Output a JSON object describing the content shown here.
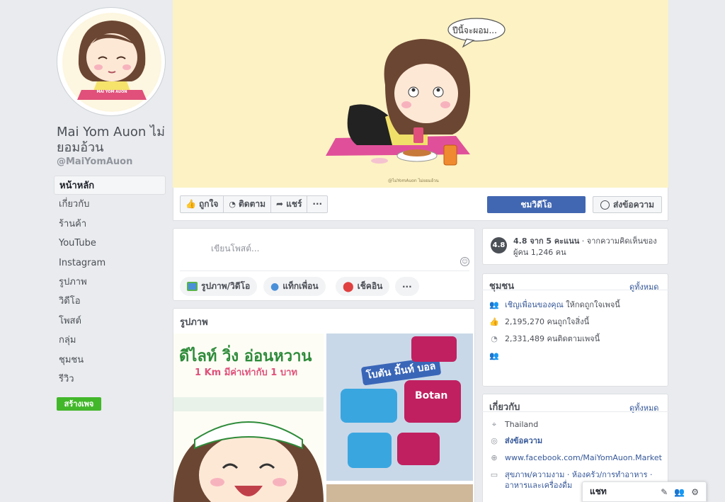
{
  "page": {
    "name": "Mai Yom Auon ไม่ยอมอ้วน",
    "handle": "@MaiYomAuon",
    "logo_text": "MAI YOM AUON"
  },
  "nav": {
    "items": [
      "หน้าหลัก",
      "เกี่ยวกับ",
      "ร้านค้า",
      "YouTube",
      "Instagram",
      "รูปภาพ",
      "วิดีโอ",
      "โพสต์",
      "กลุ่ม",
      "ชุมชน",
      "รีวิว"
    ],
    "create_page": "สร้างเพจ"
  },
  "cover": {
    "speech": "ปีนี้จะผอม...",
    "caption": "@ไม่YomAuon ไม่ยอมอ้วน"
  },
  "actions": {
    "like": "ถูกใจ",
    "follow": "ติดตาม",
    "share": "แชร์",
    "more": "···",
    "watch_video": "ชมวิดีโอ",
    "send_message": "ส่งข้อความ"
  },
  "composer": {
    "placeholder": "เขียนโพสต์...",
    "photo_video": "รูปภาพ/วิดีโอ",
    "tag_friends": "แท็กเพื่อน",
    "check_in": "เช็คอิน",
    "more": "···"
  },
  "photos": {
    "title": "รูปภาพ",
    "photo1_line1": "ดีไลท์ วิ่ง อ่อนหวาน",
    "photo1_line2": "1 Km มีค่าเท่ากับ 1 บาท",
    "photo2_label": "โบตัน มิ้นท์ บอล",
    "photo2_brand": "Botan"
  },
  "rating": {
    "score": "4.8",
    "summary": "4.8 จาก 5 คะแนน",
    "detail": " · จากความคิดเห็นของผู้คน 1,246 คน"
  },
  "community": {
    "title": "ชุมชน",
    "see_all": "ดูทั้งหมด",
    "invite_link": "เชิญเพื่อนของคุณ",
    "invite_rest": " ให้กดถูกใจเพจนี้",
    "likes": "2,195,270 คนถูกใจสิ่งนี้",
    "follows": "2,331,489 คนติดตามเพจนี้"
  },
  "about": {
    "title": "เกี่ยวกับ",
    "see_all": "ดูทั้งหมด",
    "location": "Thailand",
    "message": "ส่งข้อความ",
    "website": "www.facebook.com/MaiYomAuon.Market",
    "categories": "สุขภาพ/ความงาม · ห้องครัว/การทำอาหาร · อาหารและเครื่องดื่ม"
  },
  "chat": {
    "label": "แชท"
  },
  "colors": {
    "primary": "#4267b2",
    "link": "#365899",
    "green": "#42b72a",
    "cover_bg": "#fcf2c4"
  }
}
